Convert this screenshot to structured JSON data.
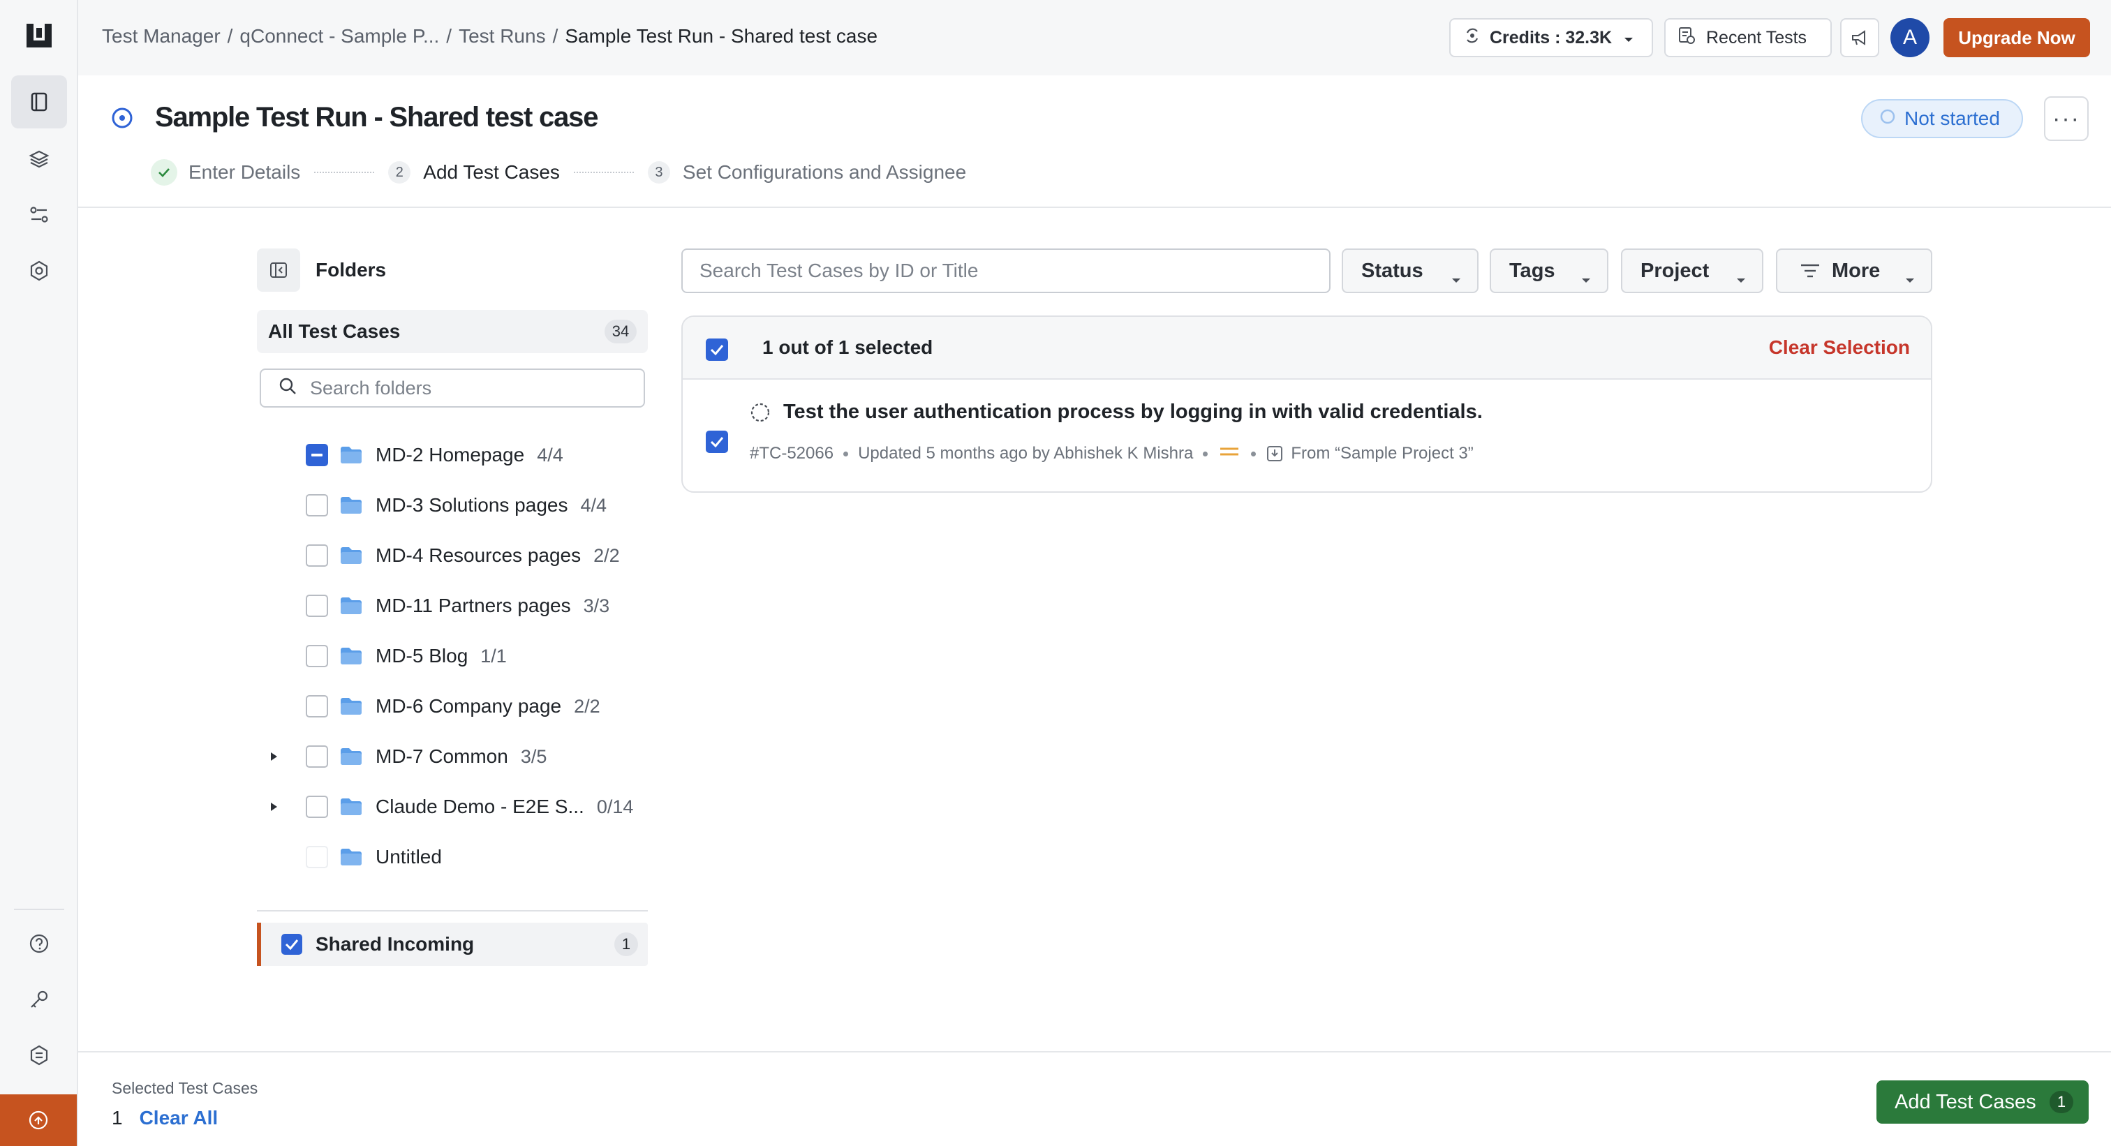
{
  "breadcrumb": [
    {
      "label": "Test Manager"
    },
    {
      "label": "qConnect - Sample P..."
    },
    {
      "label": "Test Runs"
    },
    {
      "label": "Sample Test Run - Shared test case"
    }
  ],
  "header": {
    "credits_label": "Credits : 32.3K",
    "recent_tests_label": "Recent Tests",
    "avatar_initial": "A",
    "upgrade_label": "Upgrade Now"
  },
  "page": {
    "title": "Sample Test Run - Shared test case",
    "status": "Not started",
    "kebab": "···"
  },
  "steps": [
    {
      "number": "",
      "label": "Enter Details",
      "state": "done"
    },
    {
      "number": "2",
      "label": "Add Test Cases",
      "state": "active"
    },
    {
      "number": "3",
      "label": "Set Configurations and Assignee",
      "state": "pending"
    }
  ],
  "folders": {
    "title": "Folders",
    "all_label": "All Test Cases",
    "all_count": "34",
    "search_placeholder": "Search folders",
    "items": [
      {
        "name": "MD-2 Homepage",
        "count": "4/4",
        "check": "partial",
        "expandable": false
      },
      {
        "name": "MD-3 Solutions pages",
        "count": "4/4",
        "check": "empty",
        "expandable": false
      },
      {
        "name": "MD-4 Resources pages",
        "count": "2/2",
        "check": "empty",
        "expandable": false
      },
      {
        "name": "MD-11 Partners pages",
        "count": "3/3",
        "check": "empty",
        "expandable": false
      },
      {
        "name": "MD-5 Blog",
        "count": "1/1",
        "check": "empty",
        "expandable": false
      },
      {
        "name": "MD-6 Company page",
        "count": "2/2",
        "check": "empty",
        "expandable": false
      },
      {
        "name": "MD-7 Common",
        "count": "3/5",
        "check": "empty",
        "expandable": true
      },
      {
        "name": "Claude Demo - E2E S...",
        "count": "0/14",
        "check": "empty",
        "expandable": true
      },
      {
        "name": "Untitled",
        "count": "",
        "check": "faint",
        "expandable": false
      }
    ],
    "shared_label": "Shared Incoming",
    "shared_count": "1"
  },
  "filters": {
    "search_placeholder": "Search Test Cases by ID or Title",
    "status_label": "Status",
    "tags_label": "Tags",
    "project_label": "Project",
    "more_label": "More"
  },
  "selection": {
    "summary": "1 out of 1 selected",
    "clear_label": "Clear Selection",
    "test_case": {
      "title": "Test the user authentication process by logging in with valid credentials.",
      "id": "#TC-52066",
      "updated": "Updated 5 months ago by Abhishek K Mishra",
      "source": "From “Sample Project 3”"
    }
  },
  "footer": {
    "selected_label": "Selected Test Cases",
    "selected_count": "1",
    "clear_all_label": "Clear All",
    "add_button_label": "Add Test Cases",
    "add_button_count": "1"
  },
  "colors": {
    "brand": "#c6531f",
    "primary": "#2f63d6",
    "success": "#2b7a3b",
    "danger": "#c6362b",
    "priority": "#e8a33a"
  }
}
